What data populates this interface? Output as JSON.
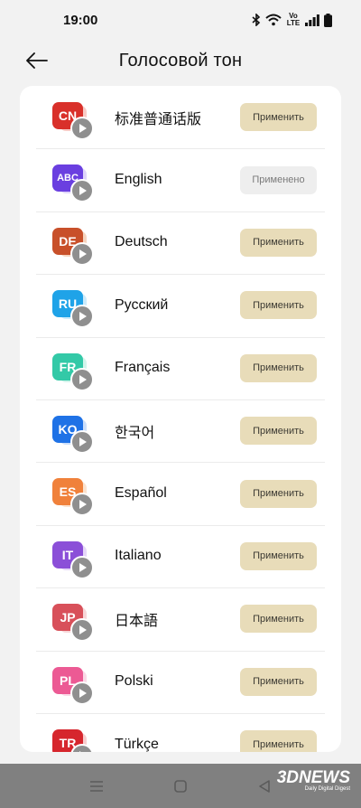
{
  "status_bar": {
    "time": "19:00",
    "network_label": "Vo LTE"
  },
  "header": {
    "title": "Голосовой тон"
  },
  "languages": [
    {
      "name": "标准普通话版",
      "code": "CN",
      "button": "Применить",
      "applied": false,
      "color": "#d9302a",
      "shadow": "#f08a7f"
    },
    {
      "name": "English",
      "code": "ABC",
      "button": "Применено",
      "applied": true,
      "color": "#6a3fe0",
      "shadow": "#b7a2f3"
    },
    {
      "name": "Deutsch",
      "code": "DE",
      "button": "Применить",
      "applied": false,
      "color": "#c8502a",
      "shadow": "#e9a070"
    },
    {
      "name": "Русский",
      "code": "RU",
      "button": "Применить",
      "applied": false,
      "color": "#1fa3e8",
      "shadow": "#8fd3f6"
    },
    {
      "name": "Français",
      "code": "FR",
      "button": "Применить",
      "applied": false,
      "color": "#33c9a7",
      "shadow": "#9ee6d4"
    },
    {
      "name": "한국어",
      "code": "KO",
      "button": "Применить",
      "applied": false,
      "color": "#1f72e6",
      "shadow": "#8eb9f3"
    },
    {
      "name": "Español",
      "code": "ES",
      "button": "Применить",
      "applied": false,
      "color": "#f0813b",
      "shadow": "#f7bf93"
    },
    {
      "name": "Italiano",
      "code": "IT",
      "button": "Применить",
      "applied": false,
      "color": "#8b4fd8",
      "shadow": "#c6a6ee"
    },
    {
      "name": "日本語",
      "code": "JP",
      "button": "Применить",
      "applied": false,
      "color": "#d8505a",
      "shadow": "#eea4a9"
    },
    {
      "name": "Polski",
      "code": "PL",
      "button": "Применить",
      "applied": false,
      "color": "#ec5a94",
      "shadow": "#f5a9c8"
    },
    {
      "name": "Türkçe",
      "code": "TR",
      "button": "Применить",
      "applied": false,
      "color": "#d6262d",
      "shadow": "#ee8e91"
    }
  ],
  "watermark": {
    "brand": "3DNEWS",
    "tagline": "Daily Digital Digest"
  },
  "icons": {
    "back": "arrow-left-icon",
    "play": "play-icon",
    "nav": [
      "menu-icon",
      "home-square-icon",
      "back-triangle-icon"
    ]
  }
}
